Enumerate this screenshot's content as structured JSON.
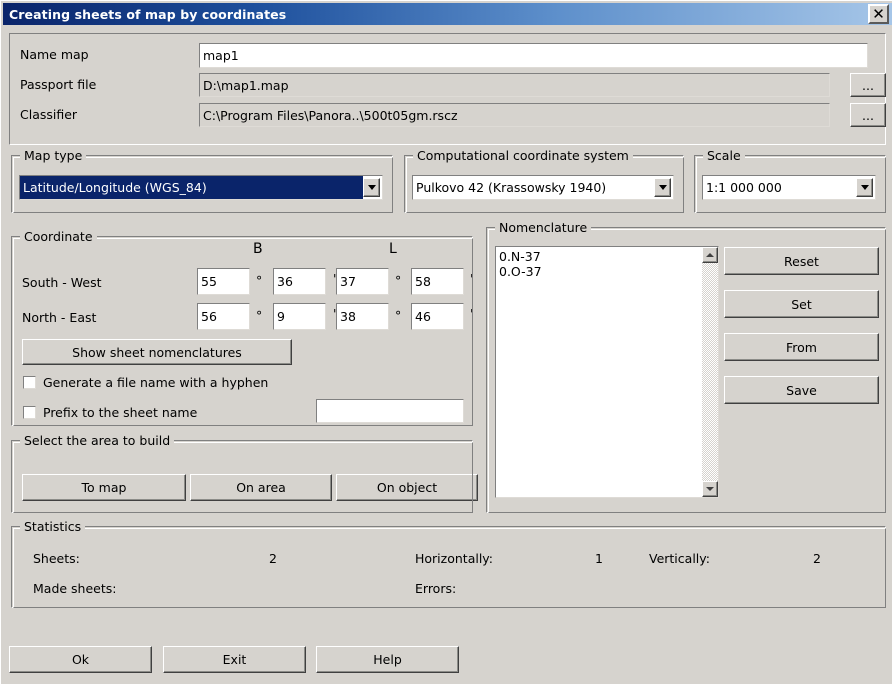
{
  "window": {
    "title": "Creating sheets of map by coordinates",
    "close_icon": "close-icon",
    "close_label": "✕"
  },
  "file_section": {
    "rows": [
      {
        "label": "Name map",
        "value": "map1",
        "editable": true,
        "browse": false
      },
      {
        "label": "Passport file",
        "value": "D:\\map1.map",
        "editable": false,
        "browse": true
      },
      {
        "label": "Classifier",
        "value": "C:\\Program Files\\Panora..\\500t05gm.rscz",
        "editable": false,
        "browse": true
      }
    ],
    "browse_label": "..."
  },
  "map_type": {
    "title": "Map type",
    "value": "Latitude/Longitude (WGS_84)",
    "selected": true,
    "highlight_color": "#0a246a"
  },
  "coord_system": {
    "title": "Computational coordinate system",
    "value": "Pulkovo 42 (Krassowsky 1940)"
  },
  "scale": {
    "title": "Scale",
    "value": "1:1 000 000"
  },
  "coordinate": {
    "title": "Coordinate",
    "col_b": "B",
    "col_l": "L",
    "deg_symbol": "°",
    "min_symbol": "'",
    "rows": [
      {
        "label": "South - West",
        "b_deg": "55",
        "b_min": "36",
        "l_deg": "37",
        "l_min": "58"
      },
      {
        "label": "North - East",
        "b_deg": "56",
        "b_min": "9",
        "l_deg": "38",
        "l_min": "46"
      }
    ],
    "show_nomenclatures_label": "Show sheet nomenclatures",
    "hyphen_checkbox": {
      "label": "Generate a file name with a hyphen",
      "checked": false
    },
    "prefix_checkbox": {
      "label": "Prefix to the sheet name",
      "checked": false
    },
    "prefix_value": ""
  },
  "nomenclature": {
    "title": "Nomenclature",
    "items": [
      "0.N-37",
      "0.O-37"
    ],
    "scroll_up_icon": "triangle-up-icon",
    "scroll_down_icon": "triangle-down-icon",
    "buttons": [
      {
        "label": "Reset"
      },
      {
        "label": "Set"
      },
      {
        "label": "From"
      },
      {
        "label": "Save"
      }
    ]
  },
  "area": {
    "title": "Select the area to build",
    "buttons": [
      {
        "label": "To map"
      },
      {
        "label": "On area"
      },
      {
        "label": "On object"
      }
    ]
  },
  "statistics": {
    "title": "Statistics",
    "sheets_label": "Sheets:",
    "sheets_value": "2",
    "horizontally_label": "Horizontally:",
    "horizontally_value": "1",
    "vertically_label": "Vertically:",
    "vertically_value": "2",
    "made_sheets_label": "Made sheets:",
    "made_sheets_value": "",
    "errors_label": "Errors:",
    "errors_value": ""
  },
  "footer": {
    "buttons": [
      {
        "label": "Ok"
      },
      {
        "label": "Exit"
      },
      {
        "label": "Help"
      }
    ]
  }
}
